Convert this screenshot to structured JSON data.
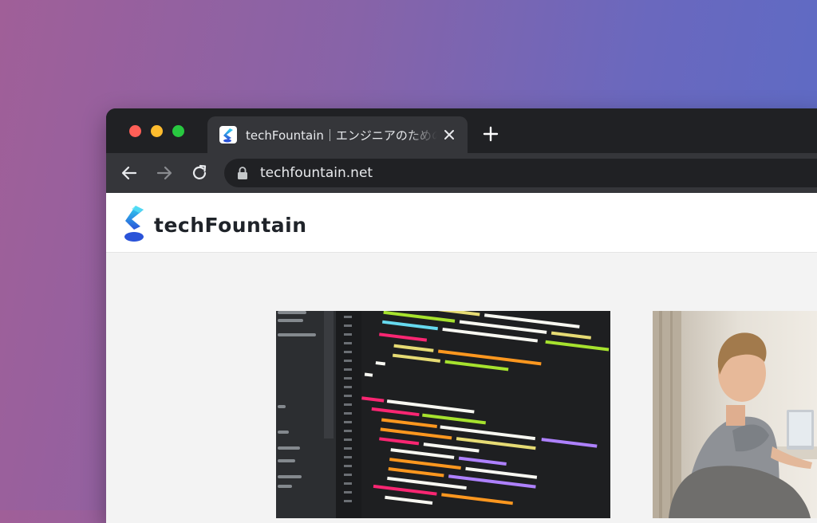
{
  "browser": {
    "tab": {
      "title": "techFountain｜エンジニアのための",
      "favicon_icon": "techfountain-logo-icon",
      "close_icon": "close-icon"
    },
    "new_tab_icon": "plus-icon",
    "nav": {
      "back_icon": "arrow-left-icon",
      "forward_icon": "arrow-right-icon",
      "reload_icon": "reload-icon"
    },
    "address_bar": {
      "url": "techfountain.net",
      "lock_icon": "lock-icon"
    },
    "colors": {
      "tabbar_bg": "#202124",
      "toolbar_bg": "#35363a",
      "traffic_close": "#ff5f57",
      "traffic_minimize": "#febc2e",
      "traffic_maximize": "#28c840"
    }
  },
  "site": {
    "name": "techFountain",
    "logo_icon": "techfountain-logo-icon",
    "colors": {
      "logo_gradient_start": "#31d4f0",
      "logo_gradient_end": "#2a53d8",
      "page_bg": "#f3f3f3",
      "header_bg": "#ffffff"
    }
  },
  "cards": [
    {
      "image": "code-editor-thumbnail"
    },
    {
      "image": "person-at-laptop-thumbnail"
    }
  ]
}
